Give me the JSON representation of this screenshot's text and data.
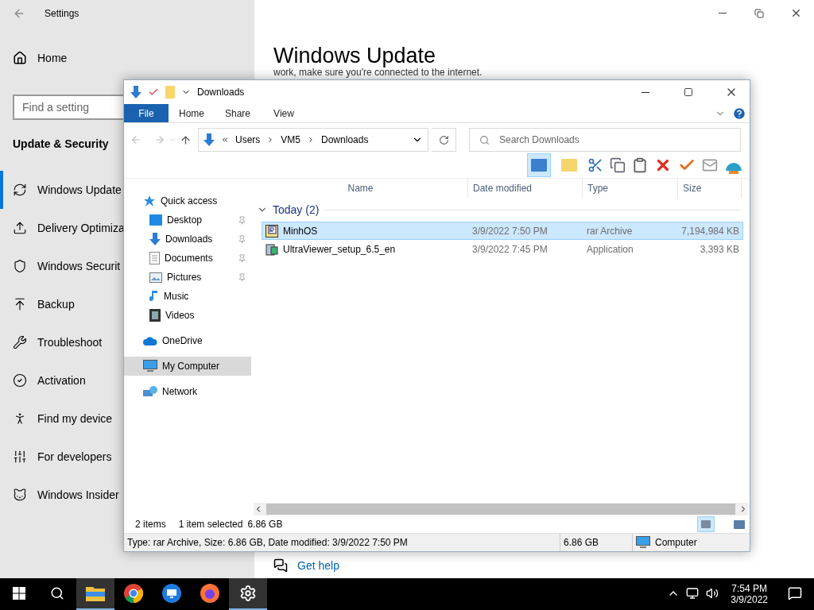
{
  "settings": {
    "title": "Settings",
    "home": "Home",
    "search_placeholder": "Find a setting",
    "section": "Update & Security",
    "items": [
      {
        "label": "Windows Update",
        "selected": true
      },
      {
        "label": "Delivery Optimiza",
        "selected": false
      },
      {
        "label": "Windows Securit",
        "selected": false
      },
      {
        "label": "Backup",
        "selected": false
      },
      {
        "label": "Troubleshoot",
        "selected": false
      },
      {
        "label": "Activation",
        "selected": false
      },
      {
        "label": "Find my device",
        "selected": false
      },
      {
        "label": "For developers",
        "selected": false
      },
      {
        "label": "Windows Insider",
        "selected": false
      }
    ],
    "page_title": "Windows Update",
    "page_text": "work, make sure you're connected to the internet.",
    "help_link": "Get help"
  },
  "explorer": {
    "title": "Downloads",
    "ribbon_tabs": [
      {
        "label": "File",
        "selected": true
      },
      {
        "label": "Home",
        "selected": false
      },
      {
        "label": "Share",
        "selected": false
      },
      {
        "label": "View",
        "selected": false
      }
    ],
    "crumbs": [
      "Users",
      "VM5",
      "Downloads"
    ],
    "search_placeholder": "Search Downloads",
    "nav": [
      {
        "label": "Quick access",
        "kind": "quick",
        "pinned": false,
        "selected": false
      },
      {
        "label": "Desktop",
        "kind": "desktop",
        "pinned": true,
        "selected": false
      },
      {
        "label": "Downloads",
        "kind": "downloads",
        "pinned": true,
        "selected": false
      },
      {
        "label": "Documents",
        "kind": "documents",
        "pinned": true,
        "selected": false
      },
      {
        "label": "Pictures",
        "kind": "pictures",
        "pinned": true,
        "selected": false
      },
      {
        "label": "Music",
        "kind": "music",
        "pinned": false,
        "selected": false
      },
      {
        "label": "Videos",
        "kind": "videos",
        "pinned": false,
        "selected": false
      },
      {
        "label": "OneDrive",
        "kind": "onedrive",
        "pinned": false,
        "selected": false
      },
      {
        "label": "My Computer",
        "kind": "computer",
        "pinned": false,
        "selected": true
      },
      {
        "label": "Network",
        "kind": "network",
        "pinned": false,
        "selected": false
      }
    ],
    "columns": [
      "Name",
      "Date modified",
      "Type",
      "Size"
    ],
    "group": "Today (2)",
    "rows": [
      {
        "name": "MinhOS",
        "date": "3/9/2022 7:50 PM",
        "type": "rar Archive",
        "size": "7,194,984 KB",
        "kind": "archive",
        "selected": true
      },
      {
        "name": "UltraViewer_setup_6.5_en",
        "date": "3/9/2022 7:45 PM",
        "type": "Application",
        "size": "3,393 KB",
        "kind": "app",
        "selected": false
      }
    ],
    "status": {
      "count": "2 items",
      "selection": "1 item selected",
      "size": "6.86 GB"
    },
    "details": {
      "text": "Type: rar Archive, Size: 6.86 GB, Date modified: 3/9/2022 7:50 PM",
      "size": "6.86 GB",
      "location": "Computer"
    }
  },
  "taskbar": {
    "apps": [
      {
        "kind": "explorer",
        "active": true
      },
      {
        "kind": "chrome",
        "active": false
      },
      {
        "kind": "remote",
        "active": false
      },
      {
        "kind": "firefox",
        "active": false
      },
      {
        "kind": "settings",
        "active": true
      }
    ],
    "time": "7:54 PM",
    "date": "3/9/2022"
  }
}
